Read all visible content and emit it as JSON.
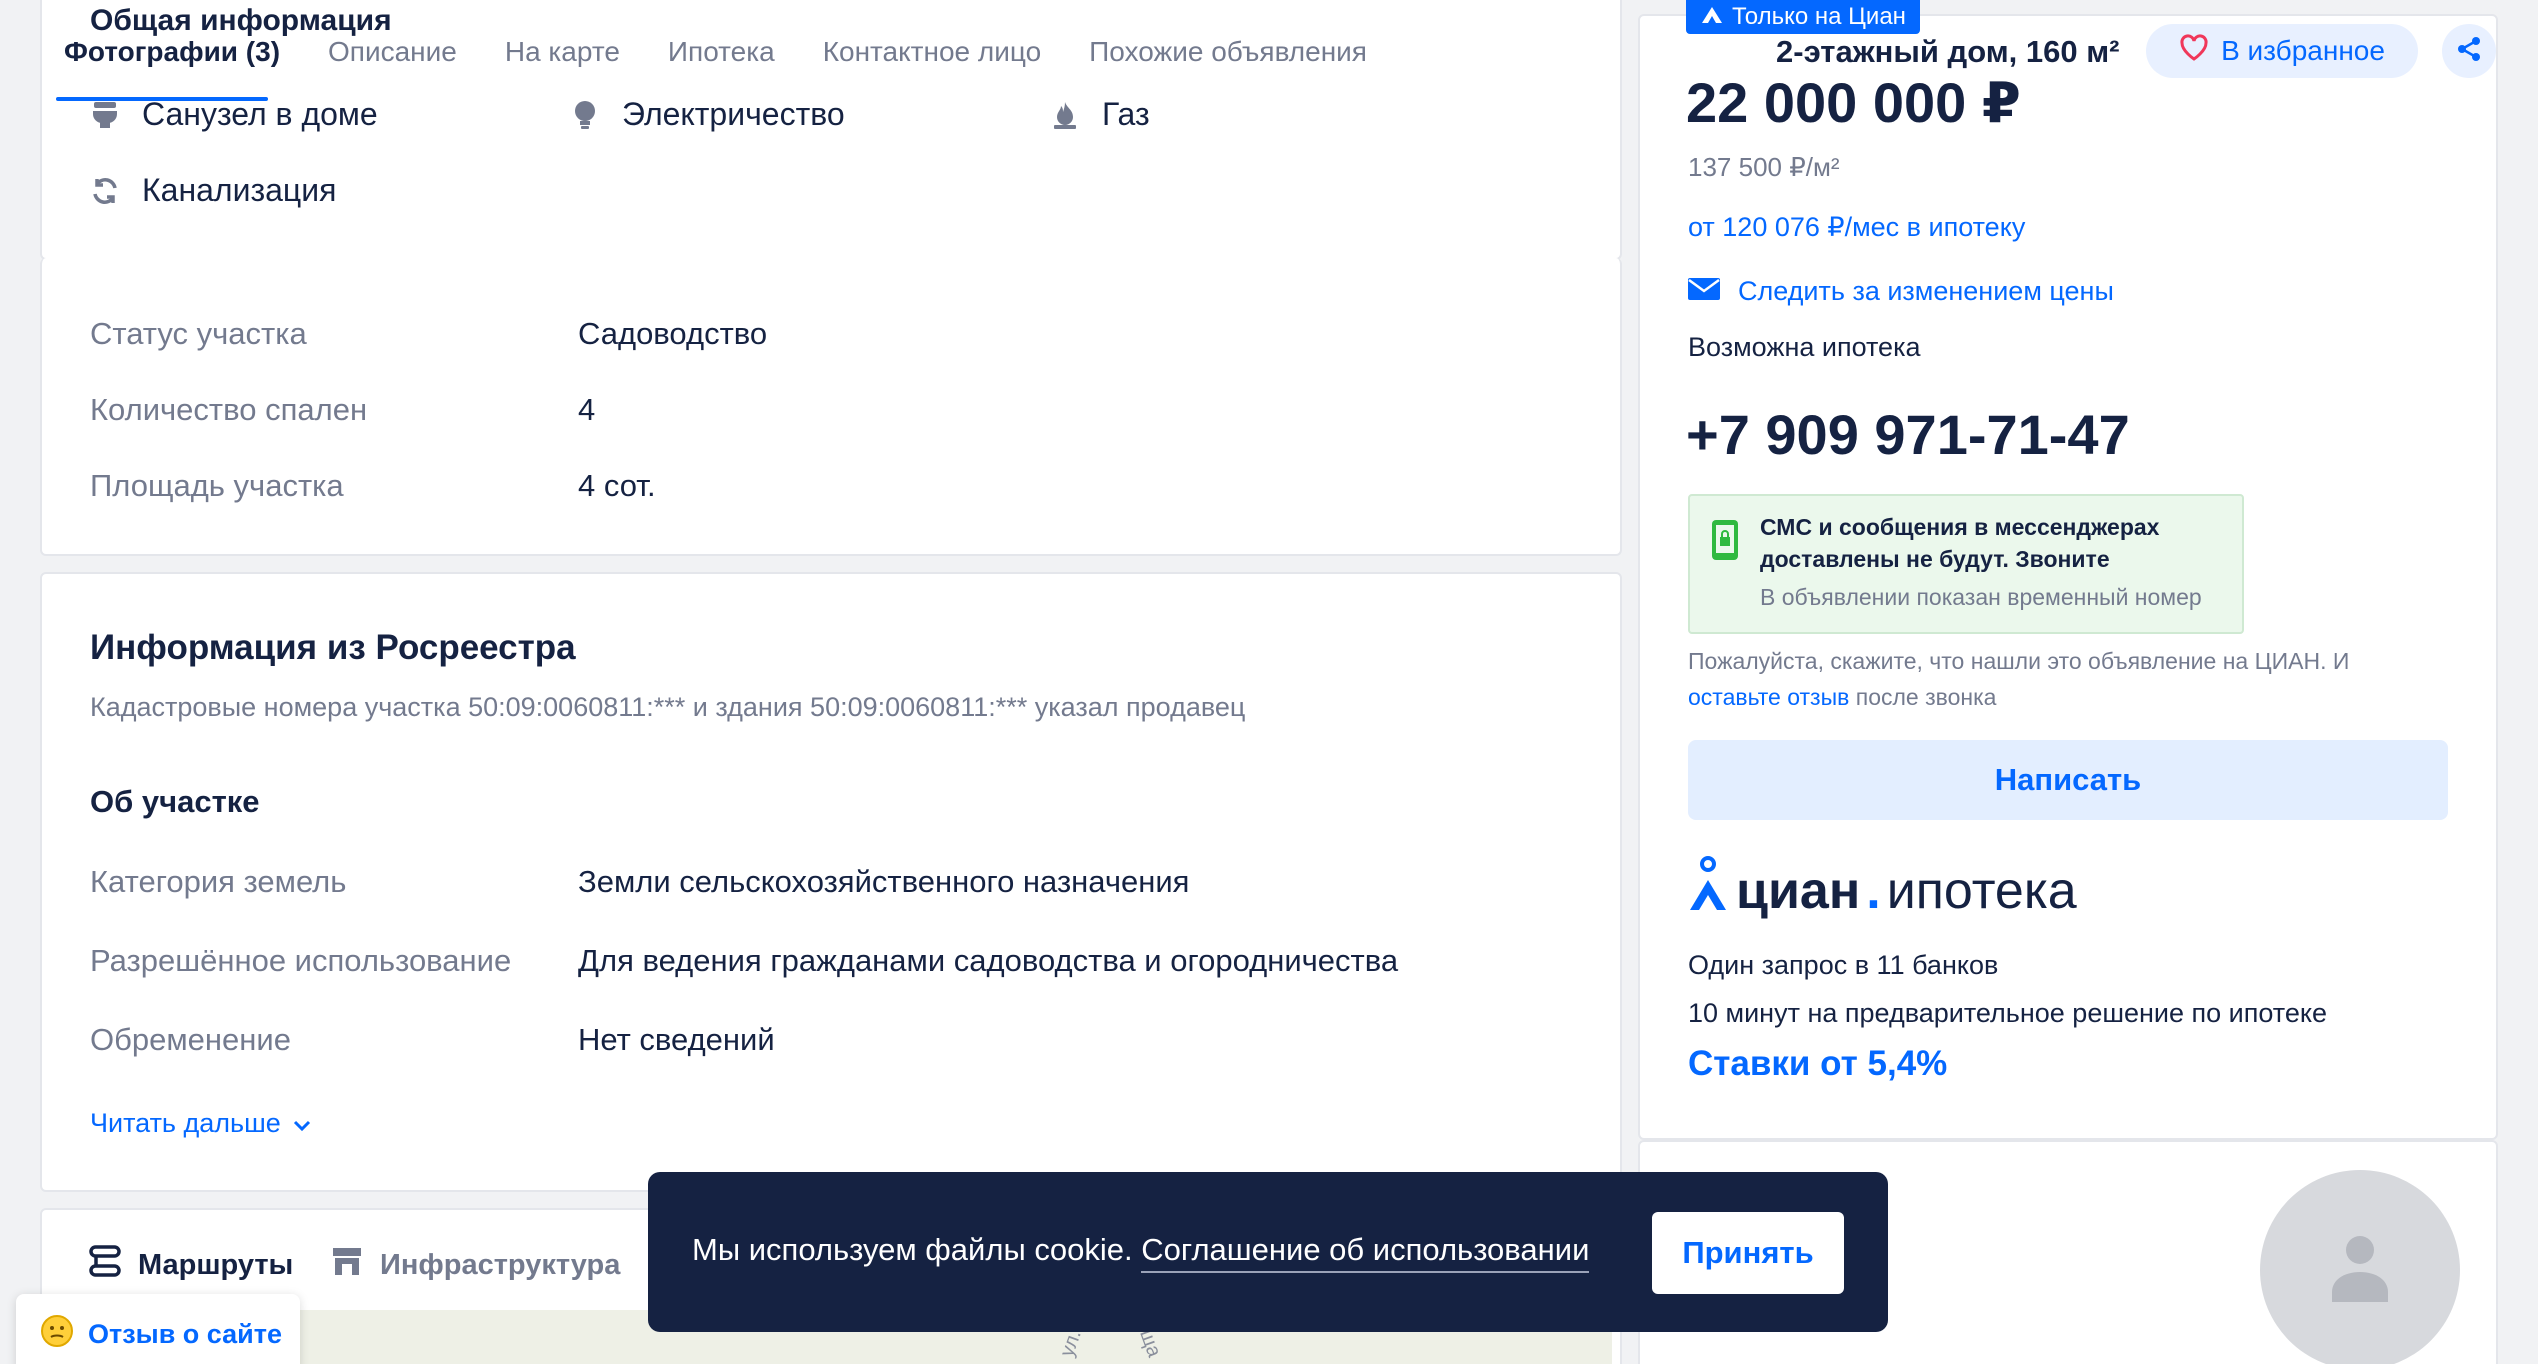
{
  "colors": {
    "accent": "#0468ff",
    "dark": "#152242",
    "muted": "#737a8e",
    "cookie_bg": "#152242",
    "favorite": "#f0375a",
    "green_lock": "#2fb940"
  },
  "header": {
    "sticky_title": "Общая информация",
    "tabs": [
      "Фотографии (3)",
      "Описание",
      "На карте",
      "Ипотека",
      "Контактное лицо",
      "Похожие объявления"
    ]
  },
  "amenities": [
    {
      "label": "Санузел в доме",
      "icon": "toilet-icon"
    },
    {
      "label": "Электричество",
      "icon": "bulb-icon"
    },
    {
      "label": "Газ",
      "icon": "gas-icon"
    },
    {
      "label": "Канализация",
      "icon": "sewer-icon"
    }
  ],
  "details": [
    {
      "label": "Статус участка",
      "value": "Садоводство"
    },
    {
      "label": "Количество спален",
      "value": "4"
    },
    {
      "label": "Площадь участка",
      "value": "4 сот."
    }
  ],
  "rosreestr": {
    "title": "Информация из Росреестра",
    "cadastral": "Кадастровые номера участка 50:09:0060811:*** и здания 50:09:0060811:*** указал продавец",
    "subtitle": "Об участке",
    "rows": [
      {
        "label": "Категория земель",
        "value": "Земли сельскохозяйственного назначения"
      },
      {
        "label": "Разрешённое использование",
        "value": "Для ведения гражданами садоводства и огородничества"
      },
      {
        "label": "Обременение",
        "value": "Нет сведений"
      }
    ],
    "read_more": "Читать дальше"
  },
  "map_tabs": [
    "Маршруты",
    "Инфраструктура"
  ],
  "offer": {
    "badge": "Только на Циан",
    "title": "2-этажный дом, 160 м²",
    "favorite": "В избранное",
    "price": "22 000 000 ₽",
    "price_per_m": "137 500 ₽/м²",
    "mortgage_from": "от 120 076 ₽/мес в ипотеку",
    "track_price": "Следить за изменением цены",
    "mortgage_possible": "Возможна ипотека",
    "phone": "+7 909 971-71-47",
    "sms_warning_line1": "СМС и сообщения в мессенджерах",
    "sms_warning_line2": "доставлены не будут. Звоните",
    "temp_number": "В объявлении показан временный номер",
    "please_say": "Пожалуйста, скажите, что нашли это объявление на ЦИАН. И",
    "leave_review": "оставьте отзыв",
    "after_call": "после звонка",
    "write_button": "Написать"
  },
  "cian_mortgage": {
    "logo_word1": "циан",
    "logo_dot": ".",
    "logo_word2": "ипотека",
    "line1": "Один запрос в 11 банков",
    "line2": "10 минут на предварительное решение по ипотеке",
    "rates": "Ставки от 5,4%"
  },
  "cookie": {
    "text": "Мы используем файлы cookie.",
    "link": "Соглашение об использовании",
    "accept": "Принять"
  },
  "feedback": {
    "label": "Отзыв о сайте"
  },
  "map_labels": [
    "ул.",
    "ща"
  ]
}
